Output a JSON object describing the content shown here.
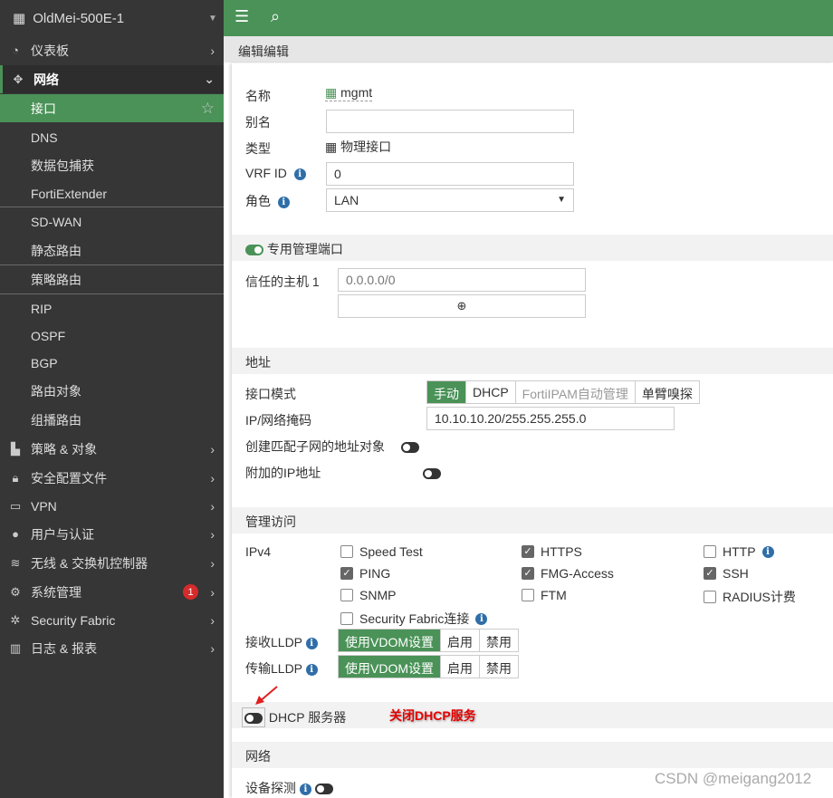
{
  "device": {
    "name": "OldMei-500E-1"
  },
  "sidebar": {
    "items": [
      {
        "label": "仪表板",
        "icon": "dashboard-icon",
        "type": "top"
      },
      {
        "label": "网络",
        "icon": "move-arrows-icon",
        "type": "group"
      },
      {
        "label": "接口",
        "type": "active"
      },
      {
        "label": "DNS",
        "type": "sub"
      },
      {
        "label": "数据包捕获",
        "type": "sub"
      },
      {
        "label": "FortiExtender",
        "type": "sub"
      },
      {
        "label": "SD-WAN",
        "type": "sub"
      },
      {
        "label": "静态路由",
        "type": "sub"
      },
      {
        "label": "策略路由",
        "type": "sub"
      },
      {
        "label": "RIP",
        "type": "sub"
      },
      {
        "label": "OSPF",
        "type": "sub"
      },
      {
        "label": "BGP",
        "type": "sub"
      },
      {
        "label": "路由对象",
        "type": "sub"
      },
      {
        "label": "组播路由",
        "type": "sub"
      },
      {
        "label": "策略 & 对象",
        "icon": "briefcase-icon",
        "type": "top"
      },
      {
        "label": "安全配置文件",
        "icon": "lock-icon",
        "type": "top"
      },
      {
        "label": "VPN",
        "icon": "laptop-icon",
        "type": "top"
      },
      {
        "label": "用户与认证",
        "icon": "user-icon",
        "type": "top"
      },
      {
        "label": "无线 & 交换机控制器",
        "icon": "wifi-icon",
        "type": "top"
      },
      {
        "label": "系统管理",
        "icon": "gear-icon",
        "type": "top",
        "badge": "1"
      },
      {
        "label": "Security Fabric",
        "icon": "fabric-icon",
        "type": "top"
      },
      {
        "label": "日志 & 报表",
        "icon": "chart-icon",
        "type": "top"
      }
    ]
  },
  "breadcrumb": "编辑编辑",
  "form": {
    "name_label": "名称",
    "name_value": "mgmt",
    "alias_label": "别名",
    "alias_value": "",
    "type_label": "类型",
    "type_value": "物理接口",
    "vrf_label": "VRF ID",
    "vrf_value": "0",
    "role_label": "角色",
    "role_value": "LAN",
    "dedicated_mgmt_label": "专用管理端口",
    "dedicated_mgmt_on": true,
    "trusted_host_label": "信任的主机 1",
    "trusted_host_placeholder": "0.0.0.0/0",
    "address_section": "地址",
    "addr_mode_label": "接口模式",
    "addr_modes": [
      "手动",
      "DHCP",
      "FortiIPAM自动管理",
      "单臂嗅探"
    ],
    "ip_label": "IP/网络掩码",
    "ip_value": "10.10.10.20/255.255.255.0",
    "create_addr_label": "创建匹配子网的地址对象",
    "secondary_ip_label": "附加的IP地址",
    "admin_section": "管理访问",
    "ipv4_label": "IPv4",
    "access": [
      {
        "label": "Speed Test",
        "checked": false
      },
      {
        "label": "HTTPS",
        "checked": true
      },
      {
        "label": "HTTP",
        "checked": false,
        "info": true
      },
      {
        "label": "PING",
        "checked": true
      },
      {
        "label": "FMG-Access",
        "checked": true
      },
      {
        "label": "SSH",
        "checked": true
      },
      {
        "label": "SNMP",
        "checked": false
      },
      {
        "label": "FTM",
        "checked": false
      },
      {
        "label": "RADIUS计费",
        "checked": false
      },
      {
        "label": "Security Fabric连接",
        "checked": false,
        "info": true
      }
    ],
    "rx_lldp_label": "接收LLDP",
    "tx_lldp_label": "传输LLDP",
    "lldp_options": [
      "使用VDOM设置",
      "启用",
      "禁用"
    ],
    "dhcp_label": "DHCP 服务器",
    "dhcp_on": false,
    "annotation": "关闭DHCP服务",
    "network_section": "网络",
    "device_detect_label": "设备探测"
  },
  "watermark": "CSDN @meigang2012",
  "colors": {
    "accent": "#4a9257",
    "sidebar": "#363636",
    "annotation": "#e60000"
  }
}
